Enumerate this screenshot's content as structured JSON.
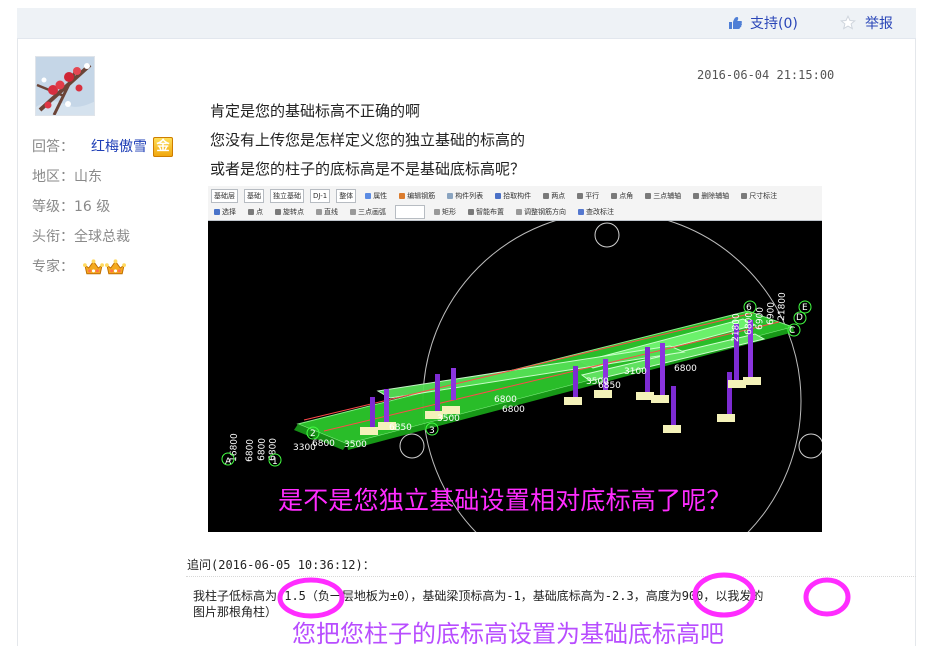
{
  "header": {
    "support_label": "支持(0)",
    "report_label": "举报"
  },
  "user": {
    "answer_label": "回答：",
    "username": "红梅傲雪",
    "badge": "金",
    "region_label": "地区：",
    "region": "山东",
    "level_label": "等级：",
    "level": "16 级",
    "title_label": "头衔：",
    "title": "全球总裁",
    "expert_label": "专家："
  },
  "post": {
    "timestamp": "2016-06-04 21:15:00",
    "lines": [
      "肯定是您的基础标高不正确的啊",
      "您没有上传您是怎样定义您的独立基础的标高的",
      "或者是您的柱子的底标高是不是基础底标高呢？"
    ]
  },
  "screenshot": {
    "toolbar_row1": [
      "基础层",
      "基础",
      "独立基础",
      "DJ-1",
      "整体",
      "属性",
      "编辑钢筋",
      "构件列表",
      "拾取构件",
      "两点",
      "平行",
      "点角",
      "三点辅轴",
      "删除辅轴",
      "尺寸标注"
    ],
    "toolbar_row2": [
      "选择",
      "点",
      "旋转点",
      "直线",
      "三点画弧",
      "矩形",
      "智能布置",
      "调整钢筋方向",
      "查改标注"
    ],
    "labels": [
      "6",
      "E",
      "D",
      "C",
      "A",
      "1",
      "2",
      "3",
      "3500",
      "6850",
      "6800",
      "3100",
      "6800",
      "3500",
      "6850",
      "3300",
      "6800",
      "6800",
      "3500",
      "21800",
      "16800",
      "6800",
      "6900",
      "6900",
      "6800",
      "21800",
      "6800",
      "6800"
    ],
    "caption": "是不是您独立基础设置相对底标高了呢？"
  },
  "followup": {
    "heading": "追问(2016-06-05 10:36:12)：",
    "line1": "我柱子低标高为-1.5（负一层地板为±0），基础梁顶标高为-1，基础底标高为-2.3，高度为900，以我发的",
    "line2": "图片那根角柱）",
    "caption": "您把您柱子的底标高设置为基础底标高吧"
  },
  "colors": {
    "link_blue": "#2a46b8",
    "annotation_magenta": "#ff2cff",
    "model_green": "#29c629",
    "model_purple": "#7d2bd2"
  }
}
